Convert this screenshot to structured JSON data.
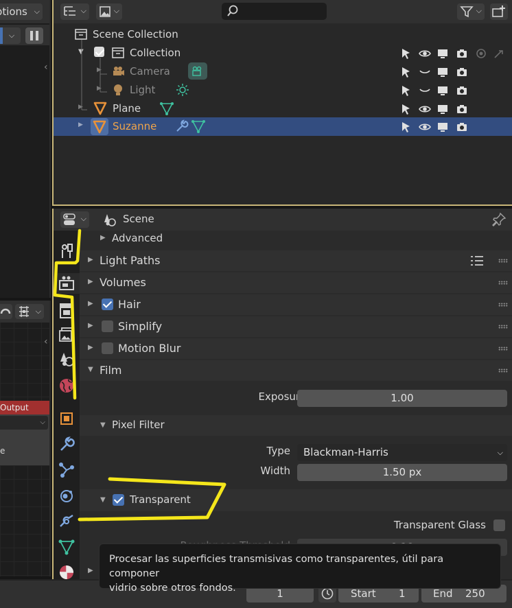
{
  "left_editor": {
    "options_label": "Options",
    "node_output_label": "Output",
    "node_field_text": "e"
  },
  "outliner": {
    "rows": [
      {
        "label": "Scene Collection"
      },
      {
        "label": "Collection"
      },
      {
        "label": "Camera"
      },
      {
        "label": "Light"
      },
      {
        "label": "Plane"
      },
      {
        "label": "Suzanne"
      }
    ]
  },
  "properties": {
    "context_label": "Scene",
    "panels": {
      "advanced": "Advanced",
      "light_paths": "Light Paths",
      "volumes": "Volumes",
      "hair": "Hair",
      "simplify": "Simplify",
      "motion_blur": "Motion Blur",
      "film": "Film",
      "pixel_filter": "Pixel Filter",
      "transparent": "Transparent"
    },
    "checkboxes": {
      "hair": true,
      "simplify": false,
      "motion_blur": false,
      "transparent": true,
      "transparent_glass": false
    },
    "film": {
      "exposure_label": "Exposure",
      "exposure_value": "1.00",
      "type_label": "Type",
      "type_value": "Blackman-Harris",
      "width_label": "Width",
      "width_value": "1.50 px",
      "transparent_glass_label": "Transparent Glass",
      "roughness_label": "Roughness Threshold",
      "roughness_value": "0.10"
    }
  },
  "tooltip": {
    "line1": "Procesar las superficies transmisivas como transparentes, útil para componer",
    "line2": "vidrio sobre otros fondos."
  },
  "timeline": {
    "current_frame": "1",
    "start_label": "Start",
    "start_value": "1",
    "end_label": "End",
    "end_value": "250"
  },
  "colors": {
    "selection": "#334d80",
    "annotation": "#f4e61b",
    "accent_blue": "#4772b3",
    "object_orange": "#e8923a",
    "mesh_green": "#3fc2a0"
  }
}
